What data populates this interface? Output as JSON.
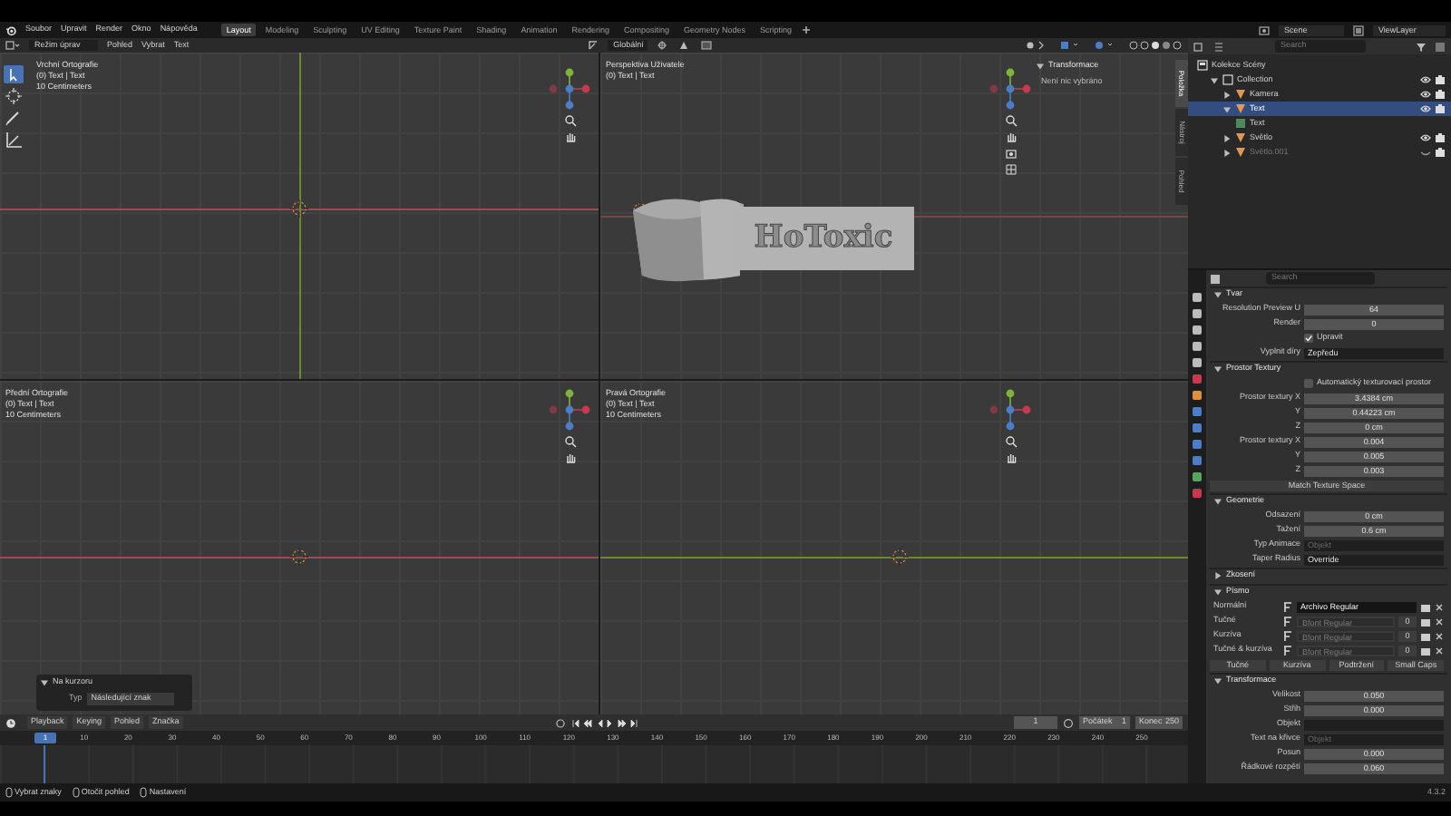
{
  "menu_bar": {
    "menus": [
      "Soubor",
      "Upravit",
      "Render",
      "Okno",
      "Nápověda"
    ],
    "workspace_tabs": [
      {
        "label": "Layout",
        "selected": true
      },
      {
        "label": "Modeling",
        "selected": false
      },
      {
        "label": "Sculpting",
        "selected": false
      },
      {
        "label": "UV Editing",
        "selected": false
      },
      {
        "label": "Texture Paint",
        "selected": false
      },
      {
        "label": "Shading",
        "selected": false
      },
      {
        "label": "Animation",
        "selected": false
      },
      {
        "label": "Rendering",
        "selected": false
      },
      {
        "label": "Compositing",
        "selected": false
      },
      {
        "label": "Geometry Nodes",
        "selected": false
      },
      {
        "label": "Scripting",
        "selected": false
      }
    ],
    "scene": "Scene",
    "view_layer": "ViewLayer"
  },
  "viewport_header": {
    "mode": "Režim úprav",
    "menus": [
      "Pohled",
      "Vybrat",
      "Text"
    ],
    "orientation": "Globální"
  },
  "viewports": [
    {
      "kind": "top",
      "title": "Vrchní Ortografie",
      "subtitle": "(0) Text | Text",
      "scale": "10 Centimeters"
    },
    {
      "kind": "perspective",
      "title": "Perspektiva Uživatele",
      "subtitle": "(0) Text | Text",
      "object_text": "HoToxic"
    },
    {
      "kind": "front",
      "title": "Přední Ortografie",
      "subtitle": "(0) Text | Text",
      "scale": "10 Centimeters"
    },
    {
      "kind": "right",
      "title": "Pravá Ortografie",
      "subtitle": "(0) Text | Text",
      "scale": "10 Centimeters"
    }
  ],
  "sidebar": {
    "tabs": [
      {
        "label": "Položka",
        "selected": true
      },
      {
        "label": "Nástroj",
        "selected": false
      },
      {
        "label": "Pohled",
        "selected": false
      }
    ],
    "panel": "Transformace",
    "message": "Není nic vybráno"
  },
  "redo_panel": {
    "title": "Na kurzoru",
    "label": "Typ",
    "value": "Následující znak"
  },
  "timeline": {
    "menus": [
      "Playback",
      "Keying",
      "Pohled",
      "Značka"
    ],
    "current_frame": "1",
    "start_label": "Počátek",
    "start": "1",
    "end_label": "Konec",
    "end": "250",
    "ruler": [
      "1",
      "10",
      "20",
      "30",
      "40",
      "50",
      "60",
      "70",
      "80",
      "90",
      "100",
      "110",
      "120",
      "130",
      "140",
      "150",
      "160",
      "170",
      "180",
      "190",
      "200",
      "210",
      "220",
      "230",
      "240",
      "250"
    ]
  },
  "status_bar": {
    "items": [
      "Vybrat znaky",
      "Otočit pohled",
      "Nastavení"
    ],
    "version": "4.3.2"
  },
  "outliner": {
    "search": "Search",
    "tree": [
      {
        "label": "Kolekce Scény",
        "kind": "scene",
        "selected": false,
        "children": [
          {
            "label": "Collection",
            "kind": "collection",
            "selected": false,
            "expanded": true,
            "children": [
              {
                "label": "Kamera",
                "kind": "object",
                "selected": false,
                "expanded": false,
                "hidden": false
              },
              {
                "label": "Text",
                "kind": "object",
                "selected": true,
                "expanded": true,
                "hidden": false,
                "children": [
                  {
                    "label": "Text",
                    "kind": "data",
                    "selected": false
                  }
                ]
              },
              {
                "label": "Světlo",
                "kind": "object",
                "selected": false,
                "expanded": false,
                "hidden": false
              },
              {
                "label": "Světlo.001",
                "kind": "object",
                "selected": false,
                "expanded": false,
                "hidden": true
              }
            ]
          }
        ]
      }
    ]
  },
  "properties": {
    "search": "Search",
    "panels": [
      {
        "title": "Tvar",
        "expanded": true,
        "rows": [
          {
            "kind": "number",
            "label": "Resolution Preview U",
            "value": "64"
          },
          {
            "kind": "number",
            "label": "Render",
            "value": "0"
          },
          {
            "kind": "checkbox",
            "label": "Upravit",
            "checked": true
          },
          {
            "kind": "dropdown",
            "label": "Vyplnit díry",
            "value": "Zepředu"
          }
        ]
      },
      {
        "title": "Prostor Textury",
        "expanded": true,
        "rows": [
          {
            "kind": "checkbox",
            "label": "Automatický texturovací prostor",
            "checked": false
          },
          {
            "kind": "number",
            "label": "Prostor textury X",
            "value": "3.4384 cm"
          },
          {
            "kind": "number",
            "label": "Y",
            "value": "0.44223 cm"
          },
          {
            "kind": "number",
            "label": "Z",
            "value": "0 cm"
          },
          {
            "kind": "number",
            "label": "Prostor textury X",
            "value": "0.004"
          },
          {
            "kind": "number",
            "label": "Y",
            "value": "0.005"
          },
          {
            "kind": "number",
            "label": "Z",
            "value": "0.003"
          },
          {
            "kind": "button",
            "label": "Match Texture Space"
          }
        ]
      },
      {
        "title": "Geometrie",
        "expanded": true,
        "rows": [
          {
            "kind": "number",
            "label": "Odsazení",
            "value": "0 cm"
          },
          {
            "kind": "number",
            "label": "Tažení",
            "value": "0.6 cm"
          },
          {
            "kind": "object",
            "label": "Typ Animace",
            "placeholder": "Objekt"
          },
          {
            "kind": "dropdown",
            "label": "Taper Radius",
            "value": "Override"
          }
        ]
      },
      {
        "title": "Zkosení",
        "expanded": false
      },
      {
        "title": "Písmo",
        "expanded": true,
        "rows": [
          {
            "kind": "font",
            "label": "Normální",
            "value": "Archivo Regular",
            "disabled": false
          },
          {
            "kind": "font",
            "label": "Tučné",
            "value": "Bfont Regular",
            "disabled": true,
            "size": "0"
          },
          {
            "kind": "font",
            "label": "Kurzíva",
            "value": "Bfont Regular",
            "disabled": true,
            "size": "0"
          },
          {
            "kind": "font",
            "label": "Tučné & kurzíva",
            "value": "Bfont Regular",
            "disabled": true,
            "size": "0"
          },
          {
            "kind": "styles",
            "items": [
              "Tučné",
              "Kurzíva",
              "Podtržení",
              "Small Caps"
            ]
          }
        ]
      },
      {
        "title": "Transformace",
        "expanded": true,
        "rows": [
          {
            "kind": "number",
            "label": "Velikost",
            "value": "0.050"
          },
          {
            "kind": "number",
            "label": "Střih",
            "value": "0.000"
          },
          {
            "kind": "field",
            "label": "Objekt"
          },
          {
            "kind": "object",
            "label": "Text na křivce",
            "placeholder": "Objekt"
          },
          {
            "kind": "number",
            "label": "Posun",
            "value": "0.000"
          },
          {
            "kind": "number",
            "label": "Řádkové rozpětí",
            "value": "0.060"
          }
        ]
      }
    ]
  }
}
